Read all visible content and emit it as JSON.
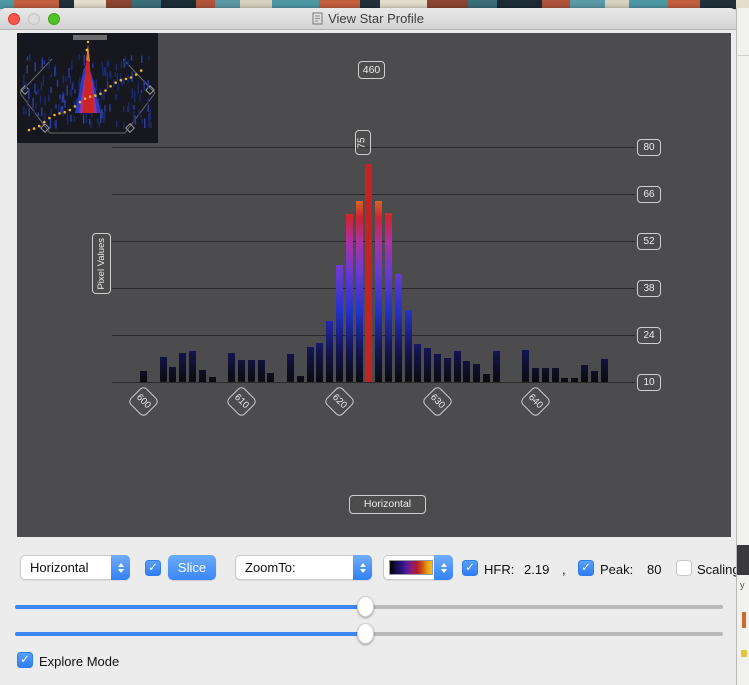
{
  "desktop_strip_colors": [
    "#4e98a6",
    "#c2603e",
    "#22303a",
    "#e4dccb",
    "#8c4632",
    "#3c6e7a",
    "#1d2b35",
    "#b0543a",
    "#5b9aa6",
    "#d9d2c0"
  ],
  "window": {
    "title": "View Star Profile"
  },
  "background_sliver": {
    "fragment_text": "y"
  },
  "chart_data": {
    "type": "bar",
    "ylabel": "Pixel Values",
    "xlabel": "Horizontal",
    "top_badge": "460",
    "peak_badge": "75",
    "y_ticks": [
      80,
      66,
      52,
      38,
      24,
      10
    ],
    "x_ticks": [
      600,
      610,
      620,
      630,
      640
    ],
    "ylim": [
      10,
      80
    ],
    "x": [
      600,
      601,
      602,
      603,
      604,
      605,
      606,
      607,
      608,
      609,
      610,
      611,
      612,
      613,
      614,
      615,
      616,
      617,
      618,
      619,
      620,
      621,
      622,
      623,
      624,
      625,
      626,
      627,
      628,
      629,
      630,
      631,
      632,
      633,
      634,
      635,
      636,
      637,
      638,
      639,
      640,
      641,
      642,
      643,
      644,
      645,
      646,
      647
    ],
    "values": [
      13.3,
      10,
      17.4,
      14.5,
      18.6,
      19.2,
      13.6,
      11.5,
      10,
      18.6,
      16.5,
      16.5,
      16.5,
      12.7,
      10,
      18.3,
      11.8,
      20.4,
      21.7,
      28.2,
      44.8,
      60,
      64,
      75,
      64,
      60.3,
      42.2,
      31.4,
      21.3,
      20.1,
      18.3,
      17.1,
      19.2,
      16.3,
      15.4,
      12.4,
      19.2,
      10,
      10,
      19.5,
      14.2,
      14.2,
      14.2,
      11.2,
      11.2,
      15.1,
      13.3,
      16.9
    ],
    "peak_x": 623,
    "peak_value": 75,
    "bar_colormap": [
      "#0b0b0e",
      "#141450",
      "#2433c8",
      "#6a3ad0",
      "#b02fa2",
      "#cf2330",
      "#d9741d",
      "#e29a22"
    ],
    "bar_colormap_stops": [
      0,
      13,
      30,
      47,
      60,
      70,
      79,
      100
    ],
    "peak_bar_color": "#c32423",
    "grid": true,
    "background": "#4c4c4e"
  },
  "controls": {
    "axis_select": {
      "value": "Horizontal"
    },
    "slice_checkbox_checked": true,
    "slice_button_label": "Slice",
    "zoom_select": {
      "value": "ZoomTo:"
    },
    "colormap_select": {
      "name": "thermal-colormap"
    },
    "hfr": {
      "checked": true,
      "label": "HFR:",
      "value": "2.19",
      "separator": ","
    },
    "peak": {
      "checked": true,
      "label": "Peak:",
      "value": "80"
    },
    "scaling": {
      "checked": false,
      "label": "Scaling"
    },
    "slider1_pct": 49.5,
    "slider2_pct": 49.5,
    "explore": {
      "checked": true,
      "label": "Explore Mode"
    }
  },
  "accent_colors": {
    "macos_blue": "#3d87f5",
    "chart_bg": "#4c4c4e"
  }
}
